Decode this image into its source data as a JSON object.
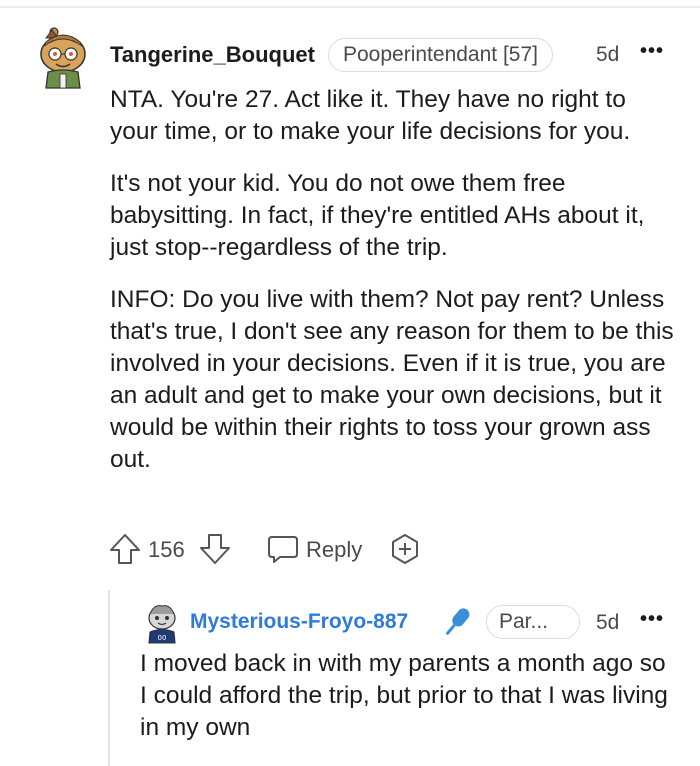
{
  "comment": {
    "username": "Tangerine_Bouquet",
    "flair": "Pooperintendant [57]",
    "time": "5d",
    "more": "•••",
    "paragraphs": [
      "NTA. You're 27. Act like it. They have no right to your time, or to make your life decisions for you.",
      "It's not your kid. You do not owe them free babysitting. In fact, if they're entitled AHs about it, just stop--regardless of the trip.",
      "INFO: Do you live with them? Not pay rent? Unless that's true, I don't see any reason for them to be this involved in your decisions. Even if it is true, you are an adult and get to make your own decisions, but it would be within their rights to toss your grown ass out."
    ],
    "actions": {
      "score": "156",
      "reply_label": "Reply"
    }
  },
  "reply": {
    "username": "Mysterious-Froyo-887",
    "flair": "Par...",
    "time": "5d",
    "more": "•••",
    "text": "I moved back in with my parents a month ago so I could afford the trip, but prior to that I was living in my own",
    "username_color": "#2f7bd8"
  },
  "icons": {
    "upvote": "arrow-up-icon",
    "downvote": "arrow-down-icon",
    "reply": "speech-bubble-icon",
    "award": "plus-award-icon",
    "mic": "microphone-icon"
  }
}
